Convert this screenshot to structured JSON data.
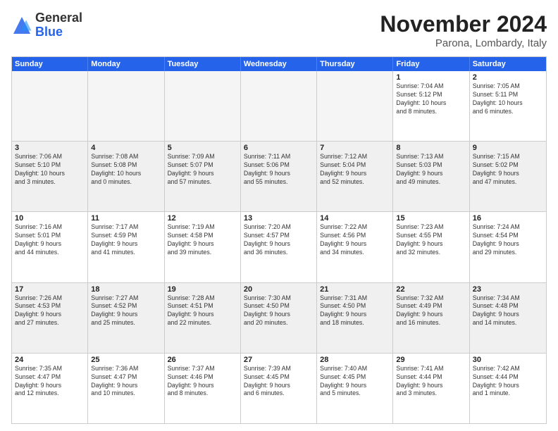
{
  "header": {
    "logo_general": "General",
    "logo_blue": "Blue",
    "month_title": "November 2024",
    "location": "Parona, Lombardy, Italy"
  },
  "weekdays": [
    "Sunday",
    "Monday",
    "Tuesday",
    "Wednesday",
    "Thursday",
    "Friday",
    "Saturday"
  ],
  "rows": [
    [
      {
        "day": "",
        "info": "",
        "empty": true
      },
      {
        "day": "",
        "info": "",
        "empty": true
      },
      {
        "day": "",
        "info": "",
        "empty": true
      },
      {
        "day": "",
        "info": "",
        "empty": true
      },
      {
        "day": "",
        "info": "",
        "empty": true
      },
      {
        "day": "1",
        "info": "Sunrise: 7:04 AM\nSunset: 5:12 PM\nDaylight: 10 hours\nand 8 minutes.",
        "empty": false
      },
      {
        "day": "2",
        "info": "Sunrise: 7:05 AM\nSunset: 5:11 PM\nDaylight: 10 hours\nand 6 minutes.",
        "empty": false
      }
    ],
    [
      {
        "day": "3",
        "info": "Sunrise: 7:06 AM\nSunset: 5:10 PM\nDaylight: 10 hours\nand 3 minutes.",
        "empty": false
      },
      {
        "day": "4",
        "info": "Sunrise: 7:08 AM\nSunset: 5:08 PM\nDaylight: 10 hours\nand 0 minutes.",
        "empty": false
      },
      {
        "day": "5",
        "info": "Sunrise: 7:09 AM\nSunset: 5:07 PM\nDaylight: 9 hours\nand 57 minutes.",
        "empty": false
      },
      {
        "day": "6",
        "info": "Sunrise: 7:11 AM\nSunset: 5:06 PM\nDaylight: 9 hours\nand 55 minutes.",
        "empty": false
      },
      {
        "day": "7",
        "info": "Sunrise: 7:12 AM\nSunset: 5:04 PM\nDaylight: 9 hours\nand 52 minutes.",
        "empty": false
      },
      {
        "day": "8",
        "info": "Sunrise: 7:13 AM\nSunset: 5:03 PM\nDaylight: 9 hours\nand 49 minutes.",
        "empty": false
      },
      {
        "day": "9",
        "info": "Sunrise: 7:15 AM\nSunset: 5:02 PM\nDaylight: 9 hours\nand 47 minutes.",
        "empty": false
      }
    ],
    [
      {
        "day": "10",
        "info": "Sunrise: 7:16 AM\nSunset: 5:01 PM\nDaylight: 9 hours\nand 44 minutes.",
        "empty": false
      },
      {
        "day": "11",
        "info": "Sunrise: 7:17 AM\nSunset: 4:59 PM\nDaylight: 9 hours\nand 41 minutes.",
        "empty": false
      },
      {
        "day": "12",
        "info": "Sunrise: 7:19 AM\nSunset: 4:58 PM\nDaylight: 9 hours\nand 39 minutes.",
        "empty": false
      },
      {
        "day": "13",
        "info": "Sunrise: 7:20 AM\nSunset: 4:57 PM\nDaylight: 9 hours\nand 36 minutes.",
        "empty": false
      },
      {
        "day": "14",
        "info": "Sunrise: 7:22 AM\nSunset: 4:56 PM\nDaylight: 9 hours\nand 34 minutes.",
        "empty": false
      },
      {
        "day": "15",
        "info": "Sunrise: 7:23 AM\nSunset: 4:55 PM\nDaylight: 9 hours\nand 32 minutes.",
        "empty": false
      },
      {
        "day": "16",
        "info": "Sunrise: 7:24 AM\nSunset: 4:54 PM\nDaylight: 9 hours\nand 29 minutes.",
        "empty": false
      }
    ],
    [
      {
        "day": "17",
        "info": "Sunrise: 7:26 AM\nSunset: 4:53 PM\nDaylight: 9 hours\nand 27 minutes.",
        "empty": false
      },
      {
        "day": "18",
        "info": "Sunrise: 7:27 AM\nSunset: 4:52 PM\nDaylight: 9 hours\nand 25 minutes.",
        "empty": false
      },
      {
        "day": "19",
        "info": "Sunrise: 7:28 AM\nSunset: 4:51 PM\nDaylight: 9 hours\nand 22 minutes.",
        "empty": false
      },
      {
        "day": "20",
        "info": "Sunrise: 7:30 AM\nSunset: 4:50 PM\nDaylight: 9 hours\nand 20 minutes.",
        "empty": false
      },
      {
        "day": "21",
        "info": "Sunrise: 7:31 AM\nSunset: 4:50 PM\nDaylight: 9 hours\nand 18 minutes.",
        "empty": false
      },
      {
        "day": "22",
        "info": "Sunrise: 7:32 AM\nSunset: 4:49 PM\nDaylight: 9 hours\nand 16 minutes.",
        "empty": false
      },
      {
        "day": "23",
        "info": "Sunrise: 7:34 AM\nSunset: 4:48 PM\nDaylight: 9 hours\nand 14 minutes.",
        "empty": false
      }
    ],
    [
      {
        "day": "24",
        "info": "Sunrise: 7:35 AM\nSunset: 4:47 PM\nDaylight: 9 hours\nand 12 minutes.",
        "empty": false
      },
      {
        "day": "25",
        "info": "Sunrise: 7:36 AM\nSunset: 4:47 PM\nDaylight: 9 hours\nand 10 minutes.",
        "empty": false
      },
      {
        "day": "26",
        "info": "Sunrise: 7:37 AM\nSunset: 4:46 PM\nDaylight: 9 hours\nand 8 minutes.",
        "empty": false
      },
      {
        "day": "27",
        "info": "Sunrise: 7:39 AM\nSunset: 4:45 PM\nDaylight: 9 hours\nand 6 minutes.",
        "empty": false
      },
      {
        "day": "28",
        "info": "Sunrise: 7:40 AM\nSunset: 4:45 PM\nDaylight: 9 hours\nand 5 minutes.",
        "empty": false
      },
      {
        "day": "29",
        "info": "Sunrise: 7:41 AM\nSunset: 4:44 PM\nDaylight: 9 hours\nand 3 minutes.",
        "empty": false
      },
      {
        "day": "30",
        "info": "Sunrise: 7:42 AM\nSunset: 4:44 PM\nDaylight: 9 hours\nand 1 minute.",
        "empty": false
      }
    ]
  ]
}
